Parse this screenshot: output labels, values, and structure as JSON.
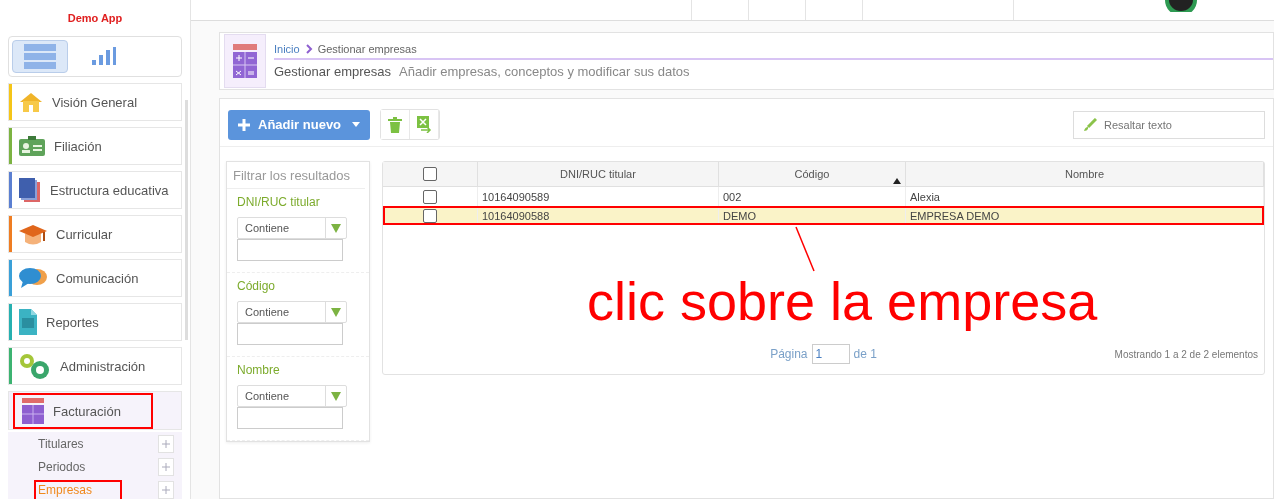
{
  "app_title": "Demo App",
  "view_switch": [
    {
      "kind": "list",
      "selected": true
    },
    {
      "kind": "chart",
      "selected": false
    }
  ],
  "nav": [
    {
      "label": "Visión General",
      "kind": "home",
      "color": "#f5c518",
      "annotated": false,
      "expanded": false
    },
    {
      "label": "Filiación",
      "kind": "card",
      "color": "#7cb342",
      "annotated": false,
      "expanded": false
    },
    {
      "label": "Estructura educativa",
      "kind": "book",
      "color": "#5b7fd1",
      "annotated": false,
      "expanded": false
    },
    {
      "label": "Curricular",
      "kind": "cap",
      "color": "#ef7d22",
      "annotated": false,
      "expanded": false
    },
    {
      "label": "Comunicación",
      "kind": "chat",
      "color": "#3aa0d8",
      "annotated": false,
      "expanded": false
    },
    {
      "label": "Reportes",
      "kind": "report",
      "color": "#26b0b0",
      "annotated": false,
      "expanded": false
    },
    {
      "label": "Administración",
      "kind": "gears",
      "color": "#3cb371",
      "annotated": false,
      "expanded": false
    },
    {
      "label": "Facturación",
      "kind": "calc",
      "color": "#f3effa",
      "annotated": true,
      "expanded": true,
      "children": [
        {
          "label": "Titulares",
          "selected": false,
          "annotated": false
        },
        {
          "label": "Periodos",
          "selected": false,
          "annotated": false
        },
        {
          "label": "Empresas",
          "selected": true,
          "annotated": true
        }
      ]
    }
  ],
  "breadcrumb": [
    "Inicio",
    "Gestionar empresas"
  ],
  "page_title": "Gestionar empresas",
  "page_subtitle": "Añadir empresas, conceptos y modificar sus datos",
  "add_button": "Añadir nuevo",
  "highlight_field": {
    "placeholder": "Resaltar texto"
  },
  "filters": {
    "title": "Filtrar los resultados",
    "items": [
      {
        "label": "DNI/RUC titular",
        "operator": "Contiene"
      },
      {
        "label": "Código",
        "operator": "Contiene"
      },
      {
        "label": "Nombre",
        "operator": "Contiene"
      }
    ]
  },
  "table": {
    "select_all_checked": false,
    "columns": [
      {
        "label": "DNI/RUC titular",
        "sorted": false
      },
      {
        "label": "Código",
        "sorted": true
      },
      {
        "label": "Nombre",
        "sorted": false
      }
    ],
    "rows": [
      {
        "checked": false,
        "selected": false,
        "annotated": false,
        "cells": [
          "10164090589",
          "002",
          "Alexia"
        ]
      },
      {
        "checked": false,
        "selected": true,
        "annotated": true,
        "cells": [
          "10164090588",
          "DEMO",
          "EMPRESA DEMO"
        ]
      }
    ]
  },
  "pager": {
    "label": "Página",
    "value": "1",
    "total": "de 1",
    "summary": "Mostrando 1 a 2 de 2 elementos"
  },
  "annotation": "clic sobre la empresa"
}
